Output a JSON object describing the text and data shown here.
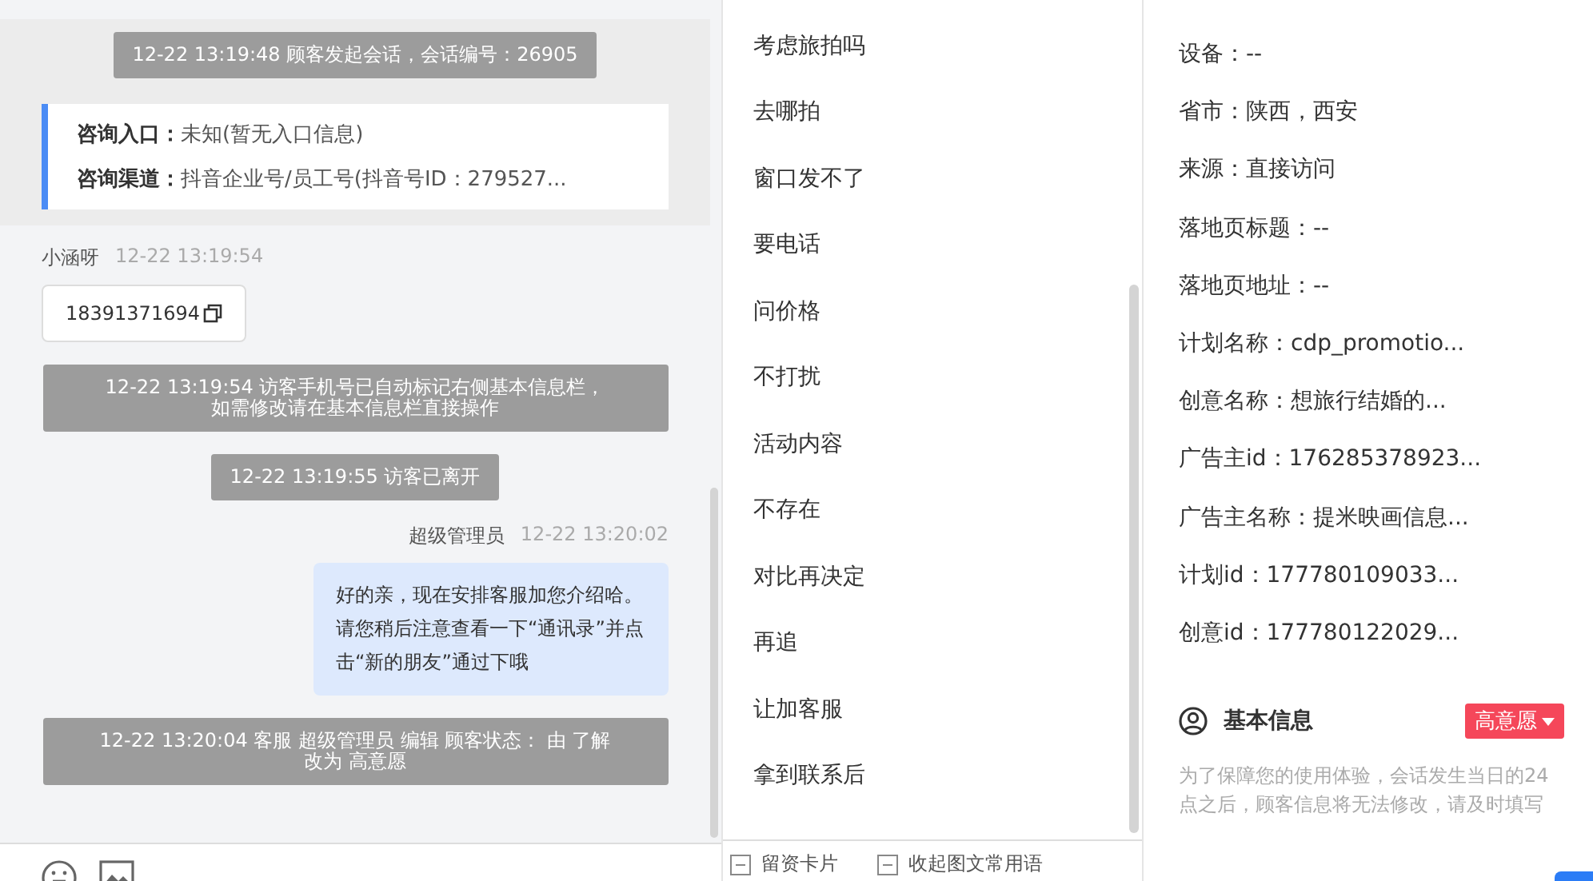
{
  "chat": {
    "session": {
      "notice": "12-22 13:19:48 顾客发起会话，会话编号：26905",
      "entries": [
        {
          "label": "咨询入口：",
          "value": "未知(暂无入口信息)"
        },
        {
          "label": "咨询渠道：",
          "value": "抖音企业号/员工号(抖音号ID：279527..."
        }
      ]
    },
    "messages": [
      {
        "kind": "visitor",
        "sender": "小涵呀",
        "time": "12-22 13:19:54",
        "text": "18391371694"
      },
      {
        "kind": "notice",
        "lines": [
          "12-22 13:19:54 访客手机号已自动标记右侧基本信息栏，",
          "如需修改请在基本信息栏直接操作"
        ]
      },
      {
        "kind": "notice",
        "lines": [
          "12-22 13:19:55 访客已离开"
        ]
      },
      {
        "kind": "agent",
        "sender": "超级管理员",
        "time": "12-22 13:20:02",
        "text": "好的亲，现在安排客服加您介绍哈。请您稍后注意查看一下“通讯录”并点击“新的朋友”通过下哦"
      },
      {
        "kind": "notice",
        "lines": [
          "12-22 13:20:04 客服 超级管理员 编辑 顾客状态： 由 了解",
          "改为 高意愿"
        ]
      }
    ]
  },
  "quick_replies": [
    "考虑旅拍吗",
    "去哪拍",
    "窗口发不了",
    "要电话",
    "问价格",
    "不打扰",
    "活动内容",
    "不存在",
    "对比再决定",
    "再追",
    "让加客服",
    "拿到联系后"
  ],
  "bottom_options": [
    "留资卡片",
    "收起图文常用语"
  ],
  "info": {
    "fields": [
      "设备：--",
      "省市：陕西，西安",
      "来源：直接访问",
      "落地页标题：--",
      "落地页地址：--",
      "计划名称：cdp_promotio...",
      "创意名称：想旅行结婚的...",
      "广告主id：176285378923...",
      "广告主名称：提米映画信息...",
      "计划id：177780109033...",
      "创意id：177780122029..."
    ],
    "basic": {
      "title": "基本信息",
      "status": "高意愿",
      "hint": "为了保障您的使用体验，会话发生当日的24点之后，顾客信息将无法修改，请及时填写"
    }
  }
}
